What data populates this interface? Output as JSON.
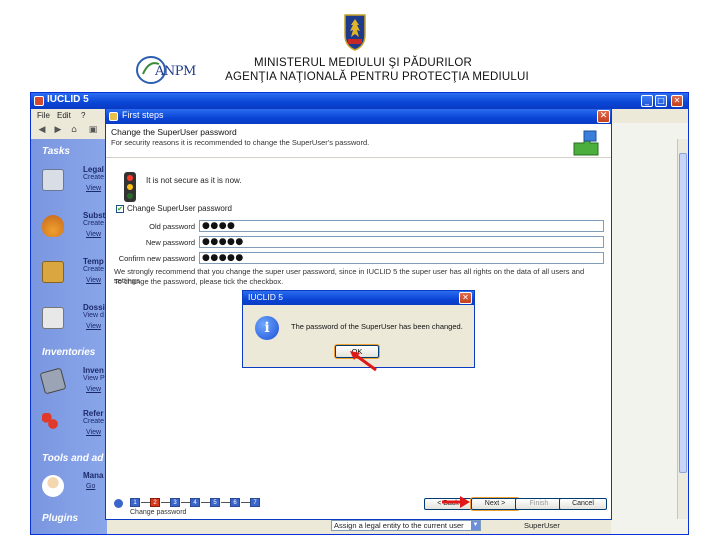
{
  "header": {
    "ministry": "MINISTERUL MEDIULUI ŞI PĂDURILOR",
    "agency": "AGENŢIA NAŢIONALĂ PENTRU PROTECŢIA MEDIULUI",
    "logo_text": "ANPM"
  },
  "window": {
    "title": "IUCLID 5",
    "menu": [
      "File",
      "Edit",
      "?"
    ]
  },
  "task_pane": {
    "sections": {
      "tasks": "Tasks",
      "inventories": "Inventories",
      "tools": "Tools and ad",
      "plugins": "Plugins"
    },
    "items": [
      {
        "title": "Legal",
        "sub": "Create",
        "link": "View"
      },
      {
        "title": "Subst",
        "sub": "Create",
        "link": "View"
      },
      {
        "title": "Temp",
        "sub": "Create",
        "link": "View"
      },
      {
        "title": "Dossi",
        "sub": "View d",
        "link": "View"
      },
      {
        "title": "Inven",
        "sub": "View P",
        "link": "View"
      },
      {
        "title": "Refer",
        "sub": "Create",
        "link": "View"
      },
      {
        "title": "Mana",
        "sub": "",
        "link": "Go"
      }
    ]
  },
  "first_steps": {
    "title": "First steps",
    "heading": "Change the SuperUser password",
    "description": "For security reasons it is recommended to change the SuperUser's password.",
    "security_status": "It is not secure as it is now.",
    "checkbox_label": "Change SuperUser password",
    "fields": [
      {
        "label": "Old password",
        "value": "●●●●"
      },
      {
        "label": "New password",
        "value": "●●●●●"
      },
      {
        "label": "Confirm new password",
        "value": "●●●●●"
      }
    ],
    "note1": "We strongly recommend that you change the super user password, since in IUCLID 5 the super user has all rights on the data of all users and settings.",
    "note2": "To change the password, please tick the checkbox.",
    "steps": [
      "1",
      "2",
      "3",
      "4",
      "5",
      "6",
      "7"
    ],
    "steps_label": "Change password",
    "buttons": {
      "back": "< Back",
      "next": "Next >",
      "finish": "Finish",
      "cancel": "Cancel"
    }
  },
  "message_box": {
    "title": "IUCLID 5",
    "text": "The password of the SuperUser has been changed.",
    "ok": "OK"
  },
  "statusbar": {
    "select_value": "Assign a legal entity to the current user",
    "user": "SuperUser"
  },
  "colors": {
    "titlebar": "#0a45d6",
    "task_pane": "#7a96df",
    "annotation_arrow": "#e01818",
    "step_done": "#d63a1e",
    "step_pending": "#3a66c9"
  },
  "icons": {
    "crest": "coat-of-arms-icon",
    "info": "info-icon",
    "puzzle": "puzzle-icon",
    "traffic_light": "traffic-light-icon"
  }
}
